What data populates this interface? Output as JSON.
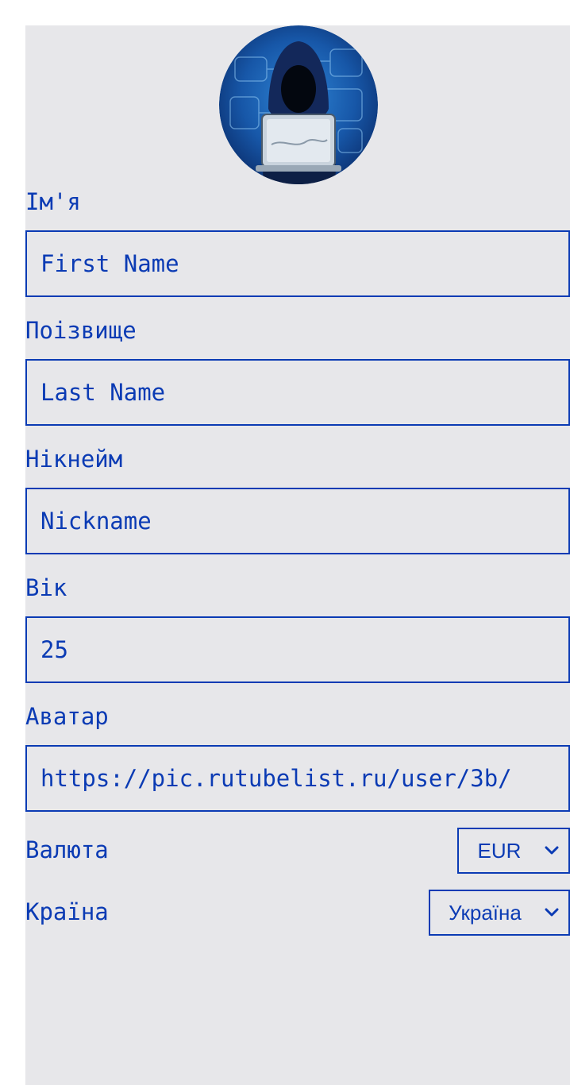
{
  "colors": {
    "accent": "#0b3bb4",
    "panel_bg": "#e7e7ea",
    "page_bg": "#ffffff"
  },
  "avatar": {
    "icon": "hooded-hacker-avatar"
  },
  "form": {
    "first_name": {
      "label": "Ім'я",
      "placeholder": "First Name",
      "value": ""
    },
    "last_name": {
      "label": "Поізвище",
      "placeholder": "Last Name",
      "value": ""
    },
    "nickname": {
      "label": "Нікнейм",
      "placeholder": "Nickname",
      "value": ""
    },
    "age": {
      "label": "Вік",
      "placeholder": "",
      "value": "25"
    },
    "avatar_url": {
      "label": "Аватар",
      "placeholder": "",
      "value": "https://pic.rutubelist.ru/user/3b/"
    },
    "currency": {
      "label": "Валюта",
      "selected": "EUR",
      "icon": "chevron-down-icon"
    },
    "country": {
      "label": "Країна",
      "selected": "Україна",
      "icon": "chevron-down-icon"
    }
  }
}
